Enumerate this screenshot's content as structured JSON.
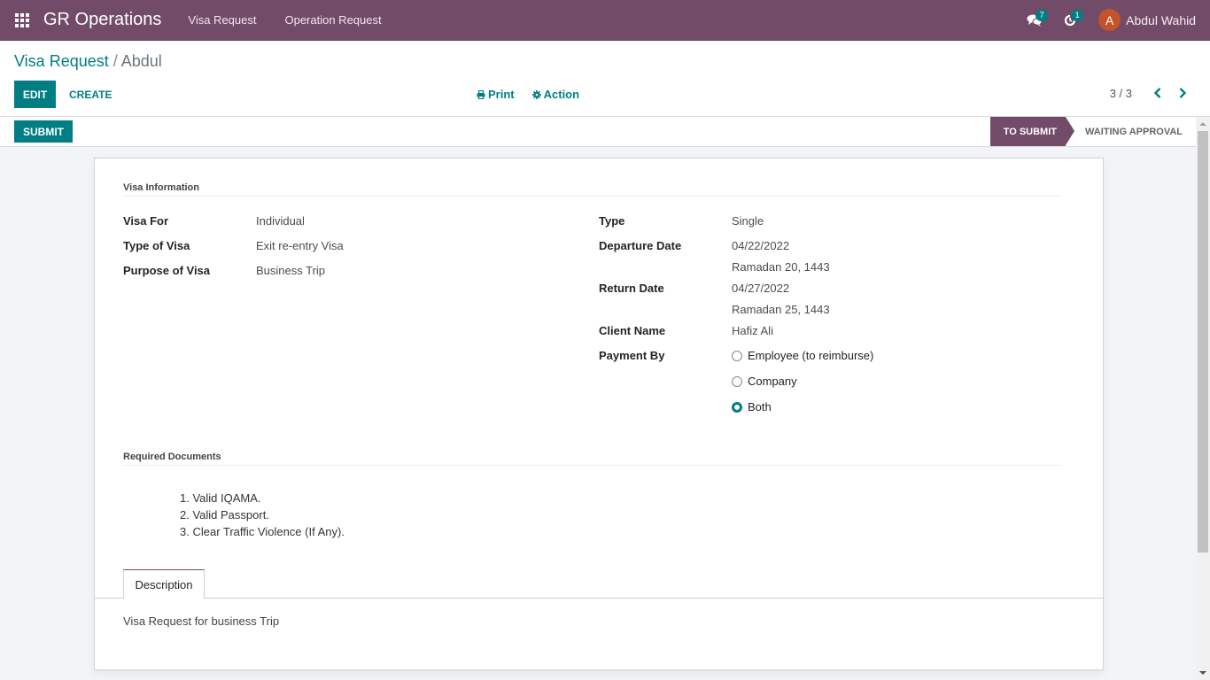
{
  "navbar": {
    "apps_icon": "apps-grid-icon",
    "brand": "GR Operations",
    "menus": [
      "Visa Request",
      "Operation Request"
    ],
    "messages_badge": "7",
    "activity_badge": "1",
    "user_initial": "A",
    "user_name": "Abdul Wahid"
  },
  "control_panel": {
    "breadcrumb_parent": "Visa Request",
    "breadcrumb_separator": " / ",
    "breadcrumb_current": "Abdul",
    "edit_label": "EDIT",
    "create_label": "CREATE",
    "print_label": "Print",
    "action_label": "Action",
    "pager": "3 / 3"
  },
  "statusbar": {
    "submit_label": "SUBMIT",
    "stages": [
      {
        "label": "TO SUBMIT",
        "active": true
      },
      {
        "label": "WAITING APPROVAL",
        "active": false
      }
    ]
  },
  "form": {
    "section_visa_info": "Visa Information",
    "left_fields": [
      {
        "label": "Visa For",
        "value": "Individual"
      },
      {
        "label": "Type of Visa",
        "value": "Exit re-entry Visa"
      },
      {
        "label": "Purpose of Visa",
        "value": "Business Trip"
      }
    ],
    "right_fields": {
      "type": {
        "label": "Type",
        "value": "Single"
      },
      "departure": {
        "label": "Departure Date",
        "value": "04/22/2022",
        "hijri": "Ramadan 20, 1443"
      },
      "return": {
        "label": "Return Date",
        "value": "04/27/2022",
        "hijri": "Ramadan 25, 1443"
      },
      "client": {
        "label": "Client Name",
        "value": "Hafiz Ali"
      },
      "payment": {
        "label": "Payment By",
        "options": [
          {
            "label": "Employee (to reimburse)",
            "checked": false
          },
          {
            "label": "Company",
            "checked": false
          },
          {
            "label": "Both",
            "checked": true
          }
        ]
      }
    },
    "section_required_docs": "Required Documents",
    "required_docs": [
      "1. Valid IQAMA.",
      "2. Valid Passport.",
      "3. Clear Traffic Violence (If Any)."
    ],
    "tabs": [
      {
        "label": "Description",
        "active": true
      }
    ],
    "description": "Visa Request for business Trip"
  },
  "colors": {
    "brand": "#714b67",
    "accent": "#017e84"
  }
}
